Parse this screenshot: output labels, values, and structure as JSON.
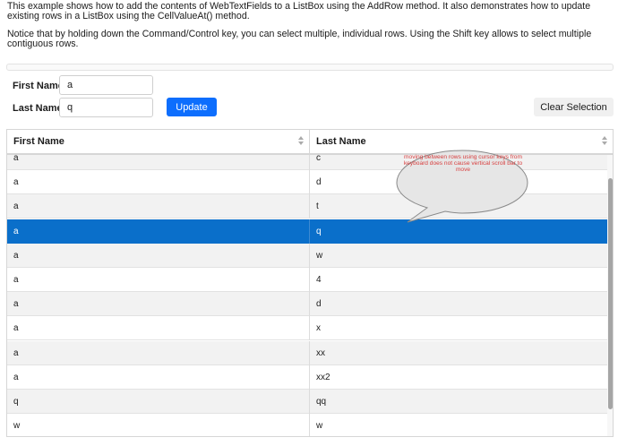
{
  "intro": {
    "paragraph1": "This example shows how to add the contents of WebTextFields to a ListBox using the AddRow method. It also demonstrates how to update existing rows in a ListBox using the CellValueAt() method.",
    "paragraph2": "Notice that by holding down the Command/Control key, you can select multiple, individual rows. Using the Shift key allows to select multiple contiguous rows."
  },
  "form": {
    "first_name_label": "First Name:",
    "first_name_value": "a",
    "last_name_label": "Last Name:",
    "last_name_value": "q",
    "update_label": "Update",
    "clear_selection_label": "Clear Selection"
  },
  "listbox": {
    "columns": [
      "First Name",
      "Last Name"
    ],
    "rows": [
      {
        "first": "a",
        "last": "c"
      },
      {
        "first": "a",
        "last": "d"
      },
      {
        "first": "a",
        "last": "t"
      },
      {
        "first": "a",
        "last": "q",
        "selected": true
      },
      {
        "first": "a",
        "last": "w"
      },
      {
        "first": "a",
        "last": "4"
      },
      {
        "first": "a",
        "last": "d"
      },
      {
        "first": "a",
        "last": "x"
      },
      {
        "first": "a",
        "last": "xx"
      },
      {
        "first": "a",
        "last": "xx2"
      },
      {
        "first": "q",
        "last": "qq"
      },
      {
        "first": "w",
        "last": "w"
      }
    ]
  },
  "annotation": {
    "text": "moving between rows using cursor keys from keyboard does not cause vertical scroll bar to move"
  },
  "colors": {
    "accent": "#0d6efd",
    "selection": "#0a6fca",
    "annotation_text": "#d84040"
  },
  "icons": [
    "sort-icon"
  ]
}
